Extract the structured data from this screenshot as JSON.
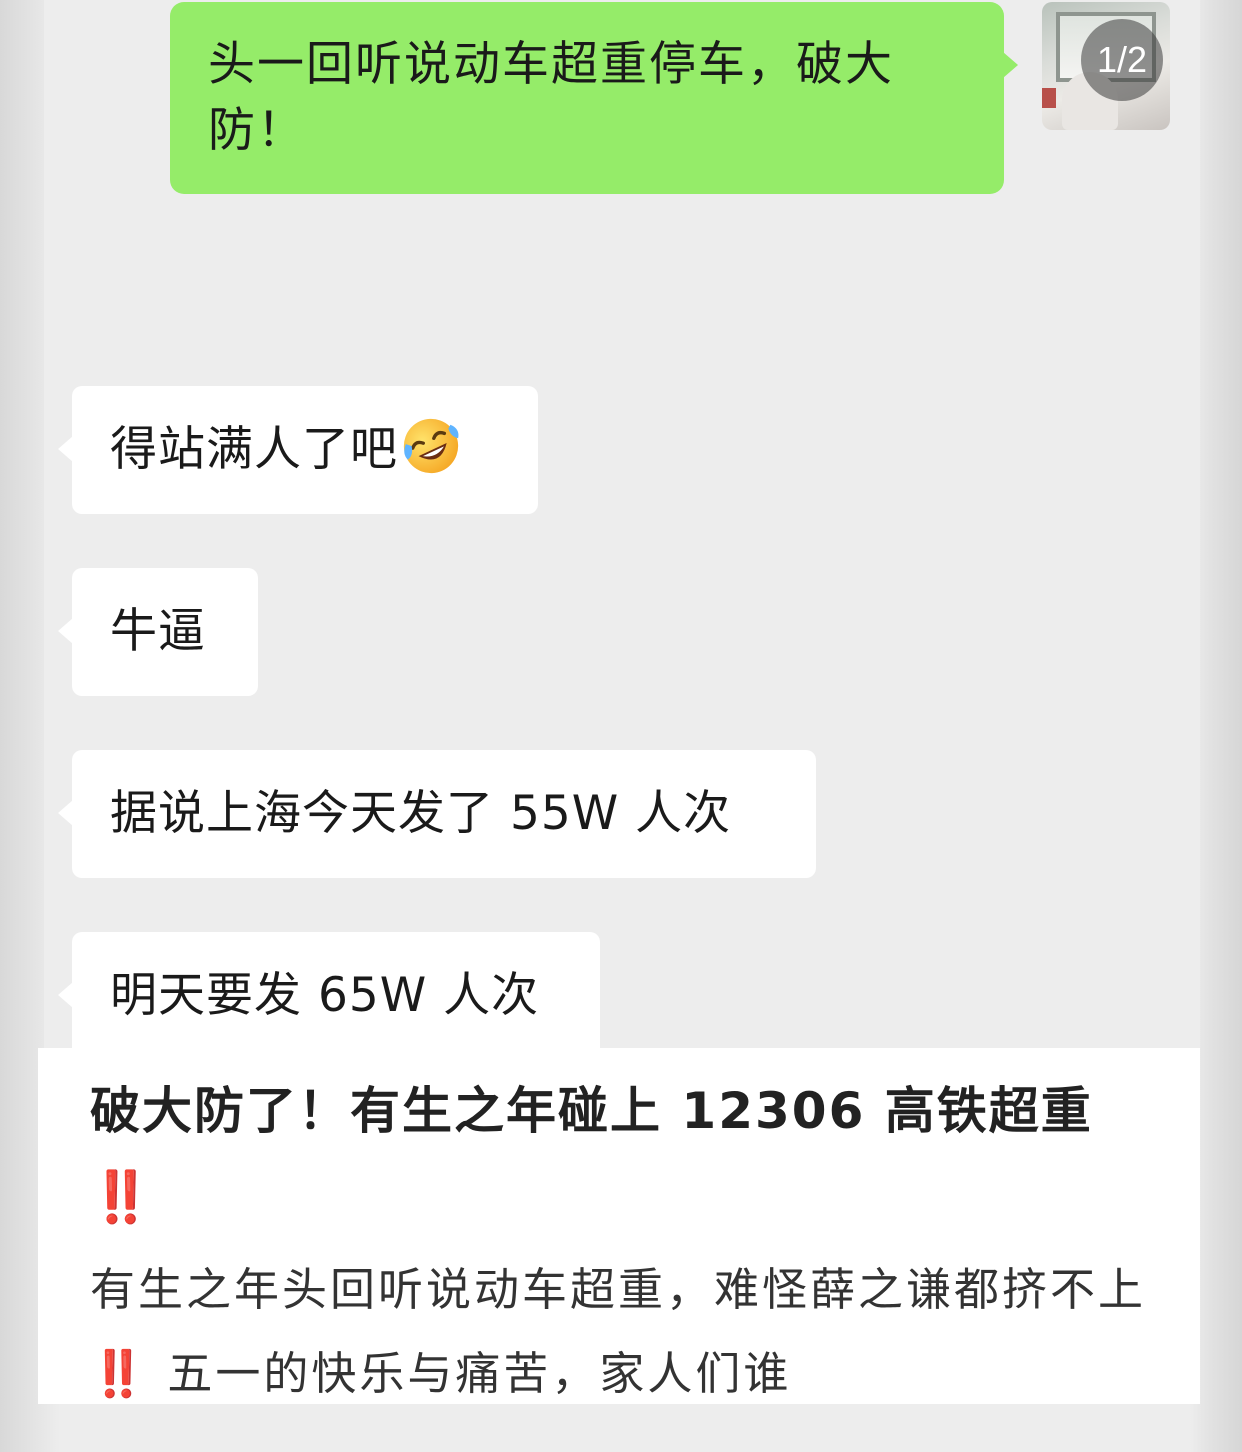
{
  "chat": {
    "sent_message": "头一回听说动车超重停车，破大防！",
    "avatar_badge": "1/2",
    "received": [
      {
        "text": "得站满人了吧",
        "emoji": "rolling-on-floor-laughing"
      },
      {
        "text": "牛逼"
      },
      {
        "text": "据说上海今天发了 55W 人次"
      },
      {
        "text": "明天要发 65W 人次"
      }
    ],
    "colors": {
      "sent_bubble": "#95ec69",
      "received_bubble": "#ffffff",
      "background": "#ededed"
    }
  },
  "article": {
    "title": "破大防了！有生之年碰上 12306 高铁超重",
    "title_bang": "‼️",
    "body_part1": "有生之年头回听说动车超重，难怪薛之谦都挤不上",
    "body_bang": "‼️",
    "body_part2": "五一的快乐与痛苦，家人们谁",
    "bang_color": "#e03030"
  }
}
